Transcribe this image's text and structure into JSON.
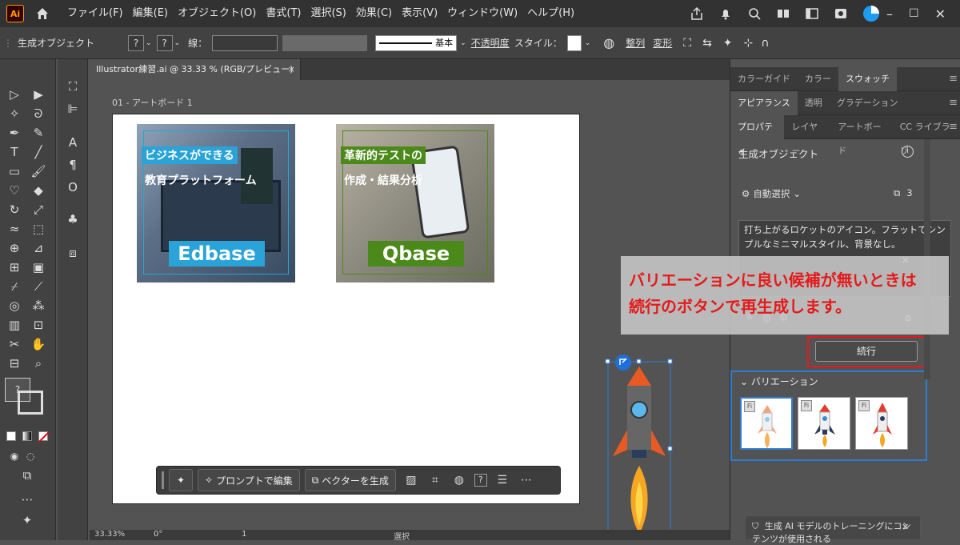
{
  "app": {
    "logo": "Ai"
  },
  "menu": [
    "ファイル(F)",
    "編集(E)",
    "オブジェクト(O)",
    "書式(T)",
    "選択(S)",
    "効果(C)",
    "表示(V)",
    "ウィンドウ(W)",
    "ヘルプ(H)"
  ],
  "controlbar": {
    "selection": "生成オブジェクト",
    "stroke_label": "線：",
    "stroke_preset": "基本",
    "opacity_label": "不透明度",
    "style_label": "スタイル：",
    "align_label": "整列",
    "transform_label": "変形"
  },
  "document": {
    "tab_title": "Illustrator練習.ai @ 33.33 % (RGB/プレビュー)",
    "close": "×",
    "artboard_label": "01 - アートボード 1"
  },
  "cards": [
    {
      "line1": "ビジネスができる",
      "line2": "教育プラットフォーム",
      "brand": "Edbase"
    },
    {
      "line1": "革新的テストの",
      "line2": "作成・結果分析",
      "brand": "Qbase"
    }
  ],
  "context_bar": {
    "edit_prompt": "プロンプトで編集",
    "generate_vector": "ベクターを生成"
  },
  "status": {
    "zoom": "33.33%",
    "angle": "0°",
    "artboard_num": "1",
    "mode": "選択"
  },
  "panel": {
    "tabs_row1": [
      "カラーガイド",
      "カラー",
      "スウォッチ"
    ],
    "tabs_row2": [
      "アピアランス",
      "透明",
      "グラデーション"
    ],
    "tabs_row3": [
      "プロパティ",
      "レイヤー",
      "アートボード",
      "CC ライブラリ"
    ],
    "section_title": "生成オブジェクト",
    "auto_select": "自動選択",
    "count": "3",
    "prompt_text": "打ち上がるロケットのアイコン。フラットでシンプルなミニマルスタイル、背景なし。",
    "continue_label": "続行",
    "variations_label": "バリエーション",
    "thumb_badge": "Fi",
    "notice": "生成 AI モデルのトレーニングにコンテンツが使用される"
  },
  "annotation": {
    "line1": "バリエーションに良い候補が無いときは",
    "line2": "続行のボタンで再生成します。"
  },
  "colors": {
    "highlight_red": "#e8171d",
    "highlight_blue": "#2e7dd4",
    "edbase": "#2aa3d8",
    "qbase": "#4b8a1a"
  }
}
